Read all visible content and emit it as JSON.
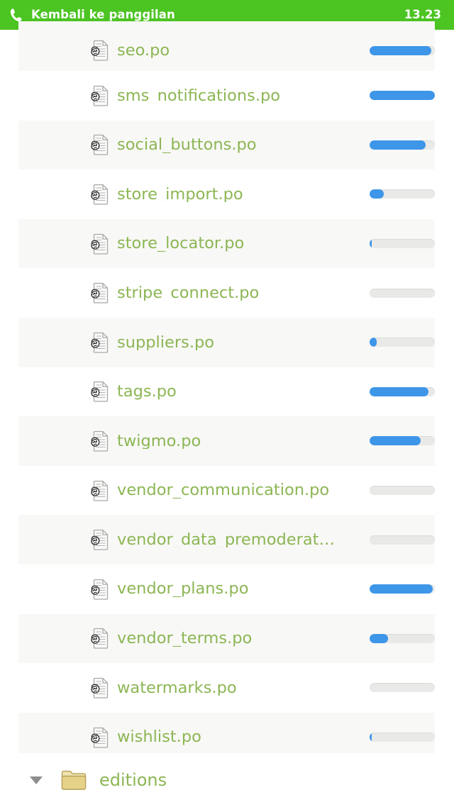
{
  "callbar": {
    "icon": "phone-icon",
    "label": "Kembali ke panggilan",
    "time": "13.23",
    "background_color": "#4cc422",
    "text_color": "#ffffff"
  },
  "list": {
    "stripe_color": "#f8f8f6",
    "label_color": "#8cb654",
    "progress_track_color": "#e9e9e7",
    "progress_fill_color": "#3d96e8",
    "file_icon": "po-file-icon",
    "rows": [
      {
        "label": "seo.po",
        "progress": 95,
        "clipped": true
      },
      {
        "label": "sms_notifications.po",
        "progress": 100
      },
      {
        "label": "social_buttons.po",
        "progress": 86
      },
      {
        "label": "store_import.po",
        "progress": 22
      },
      {
        "label": "store_locator.po",
        "progress": 3
      },
      {
        "label": "stripe_connect.po",
        "progress": 0
      },
      {
        "label": "suppliers.po",
        "progress": 11
      },
      {
        "label": "tags.po",
        "progress": 90
      },
      {
        "label": "twigmo.po",
        "progress": 78
      },
      {
        "label": "vendor_communication.po",
        "progress": 0
      },
      {
        "label": "vendor_data_premoderat…",
        "progress": 0
      },
      {
        "label": "vendor_plans.po",
        "progress": 97
      },
      {
        "label": "vendor_terms.po",
        "progress": 28
      },
      {
        "label": "watermarks.po",
        "progress": 0
      },
      {
        "label": "wishlist.po",
        "progress": 3
      }
    ]
  },
  "folder": {
    "caret": "caret-down-icon",
    "icon": "folder-icon",
    "label": "editions",
    "icon_color": "#e5d28b"
  }
}
